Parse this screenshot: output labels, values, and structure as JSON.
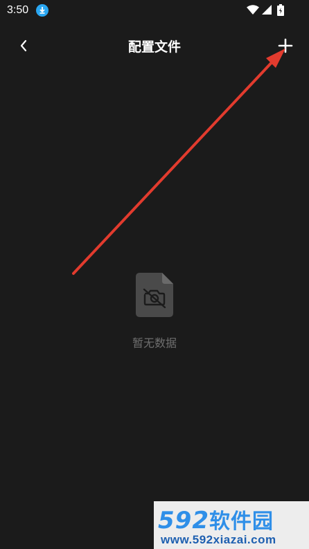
{
  "status_bar": {
    "time": "3:50",
    "download_icon": "download-badge-icon",
    "wifi_icon": "wifi-icon",
    "signal_icon": "signal-icon",
    "battery_icon": "battery-charging-icon"
  },
  "header": {
    "back_icon": "chevron-left-icon",
    "title": "配置文件",
    "add_icon": "plus-icon"
  },
  "empty_state": {
    "icon": "no-file-icon",
    "message": "暂无数据"
  },
  "annotation": {
    "color": "#e23b2e"
  },
  "watermark": {
    "logo_number": "592",
    "logo_text": "软件园",
    "url": "www.592xiazai.com"
  },
  "colors": {
    "background": "#1b1b1b",
    "accent_download": "#2aa7f2",
    "muted_text": "#6f6f6f",
    "watermark_blue": "#2f8fe8"
  }
}
